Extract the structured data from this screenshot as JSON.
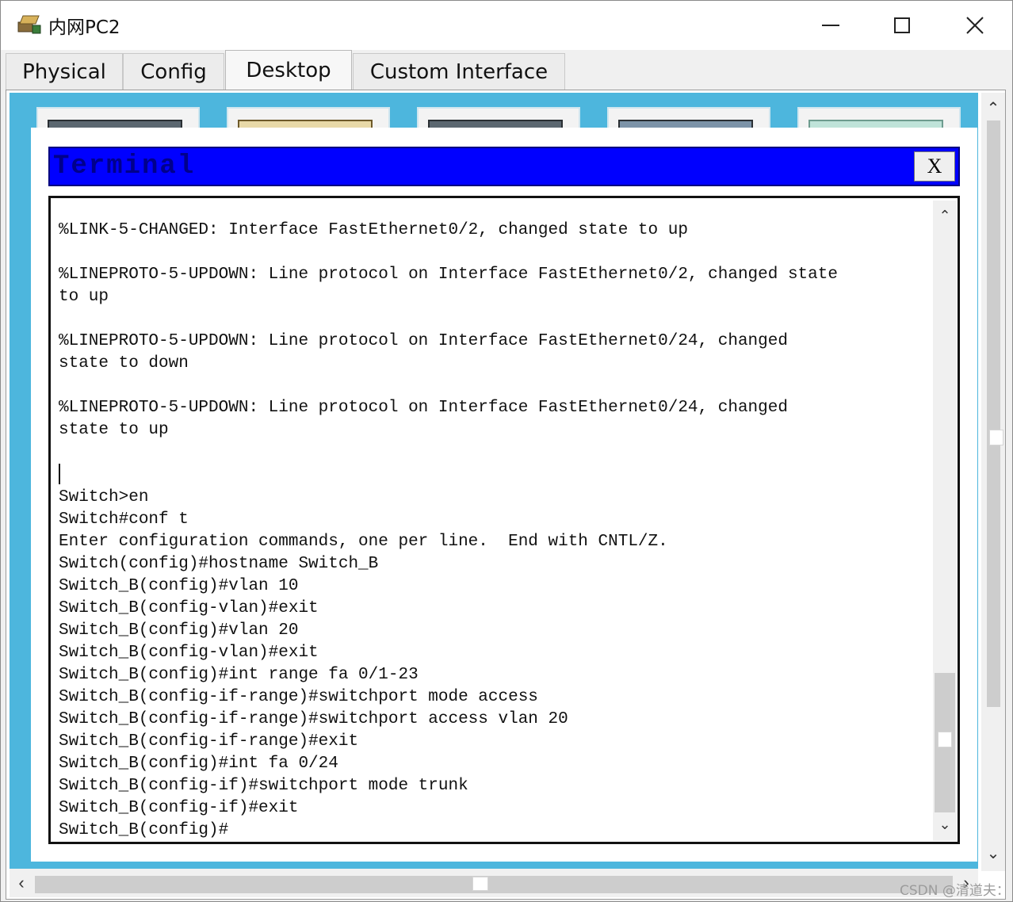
{
  "window": {
    "title": "内网PC2",
    "app_icon": "packet-tracer-icon"
  },
  "window_controls": {
    "minimize": "minimize-icon",
    "maximize": "maximize-icon",
    "close": "close-icon"
  },
  "tabs": [
    {
      "label": "Physical"
    },
    {
      "label": "Config"
    },
    {
      "label": "Desktop",
      "active": true
    },
    {
      "label": "Custom Interface"
    }
  ],
  "terminal": {
    "title": "Terminal",
    "close_label": "X",
    "lines": [
      "%LINK-5-CHANGED: Interface FastEthernet0/2, changed state to up",
      "",
      "%LINEPROTO-5-UPDOWN: Line protocol on Interface FastEthernet0/2, changed state",
      "to up",
      "",
      "%LINEPROTO-5-UPDOWN: Line protocol on Interface FastEthernet0/24, changed",
      "state to down",
      "",
      "%LINEPROTO-5-UPDOWN: Line protocol on Interface FastEthernet0/24, changed",
      "state to up",
      "",
      "",
      "Switch>en",
      "Switch#conf t",
      "Enter configuration commands, one per line.  End with CNTL/Z.",
      "Switch(config)#hostname Switch_B",
      "Switch_B(config)#vlan 10",
      "Switch_B(config-vlan)#exit",
      "Switch_B(config)#vlan 20",
      "Switch_B(config-vlan)#exit",
      "Switch_B(config)#int range fa 0/1-23",
      "Switch_B(config-if-range)#switchport mode access",
      "Switch_B(config-if-range)#switchport access vlan 20",
      "Switch_B(config-if-range)#exit",
      "Switch_B(config)#int fa 0/24",
      "Switch_B(config-if)#switchport mode trunk",
      "Switch_B(config-if)#exit",
      "Switch_B(config)#"
    ]
  },
  "watermark": "CSDN @清道夫："
}
